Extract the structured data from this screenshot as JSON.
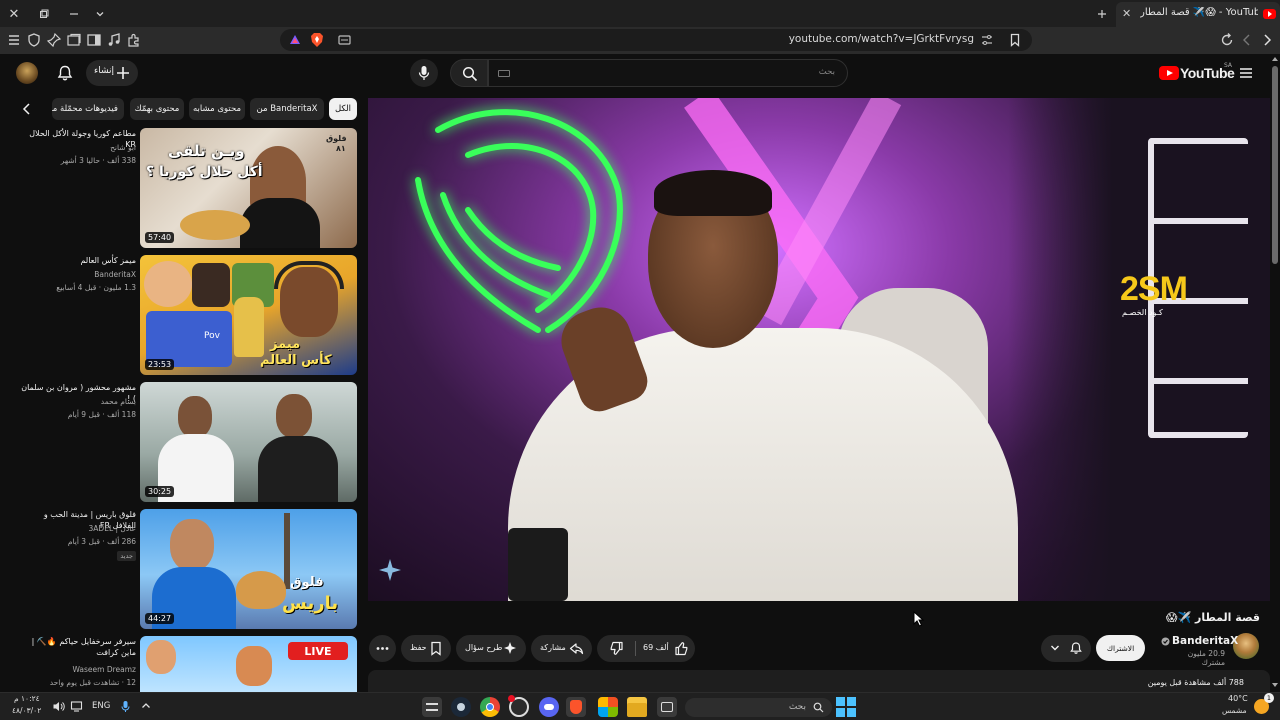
{
  "browser": {
    "tab_title": "قصة المطار ✈️😱 - YouTube",
    "url": "youtube.com/watch?v=JGrktFvrysg",
    "win_close": "✕"
  },
  "masthead": {
    "logo_text": "YouTube",
    "region": "SA",
    "search_placeholder": "بحث",
    "create_label": "إنشاء"
  },
  "chips": [
    {
      "label": "الكل",
      "active": true
    },
    {
      "label": "من BanderitaX"
    },
    {
      "label": "محتوى مشابه"
    },
    {
      "label": "محتوى بهمّك"
    },
    {
      "label": "فيديوهات محمّلة مؤخرًا"
    }
  ],
  "recommendations": [
    {
      "title": "مطاعم كوريا وجولة الأكل الحلال KR",
      "channel": "ابو شانح",
      "meta": "338 ألف · حاليا 3 أشهر",
      "duration": "57:40",
      "thumb_text": [
        "فلوق",
        "٨١",
        "ويـن تلقى",
        "أكل حلال كوريا ؟"
      ]
    },
    {
      "title": "ميمز كأس العالم",
      "channel": "BanderitaX",
      "meta": "1.3 مليون · قبل 4 أسابيع",
      "duration": "23:53",
      "thumb_text": [
        "ميمز",
        "كأس العالم",
        "Pov"
      ]
    },
    {
      "title": "مشهور محشور ( مروان بن سلمان ) !",
      "channel": "بسام محمد",
      "meta": "118 ألف · قبل 9 أيام",
      "duration": "30:25"
    },
    {
      "title": "فلوق باريس | مدينة الحب و الفلافل FR",
      "channel": "عادل | 3ADEL",
      "meta": "286 ألف · قبل 3 أيام",
      "badge": "جديد",
      "duration": "44:27",
      "thumb_text": [
        "فلوق",
        "باريس"
      ]
    },
    {
      "title": "سيرفر سرخفايل حياكم 🔥⛏️ | ماين كرافت",
      "channel": "Waseem Dreamz",
      "meta": "12 · تشاهدت قبل يوم واحد",
      "live": "LIVE"
    }
  ],
  "player": {
    "sponsor_big": "2SM",
    "sponsor_small": "كـود الخصـم"
  },
  "video": {
    "title": "قصة المطار ✈️😱",
    "channel": "BanderitaX",
    "subscribers": "20.9 مليون مشترك",
    "subscribe_label": "الاشتراك",
    "likes": "69 ألف",
    "share_label": "مشاركة",
    "ask_label": "طرح سؤال",
    "save_label": "حفظ",
    "views": "788 ألف مشاهدة قبل يومين"
  },
  "taskbar": {
    "search_placeholder": "بحث",
    "language": "ENG",
    "time": "١٠:٢٤ م",
    "date": "٤٨/٠٣/٠٢",
    "temperature": "40°C",
    "weather": "مشمس",
    "notification_count": "1"
  },
  "colors": {
    "bg": "#0f0f0f",
    "chip": "#272727",
    "youtube_red": "#ff0000",
    "live_red": "#e21f1f",
    "neon_green": "#39ff5a",
    "neon_pink": "#e25cff"
  }
}
